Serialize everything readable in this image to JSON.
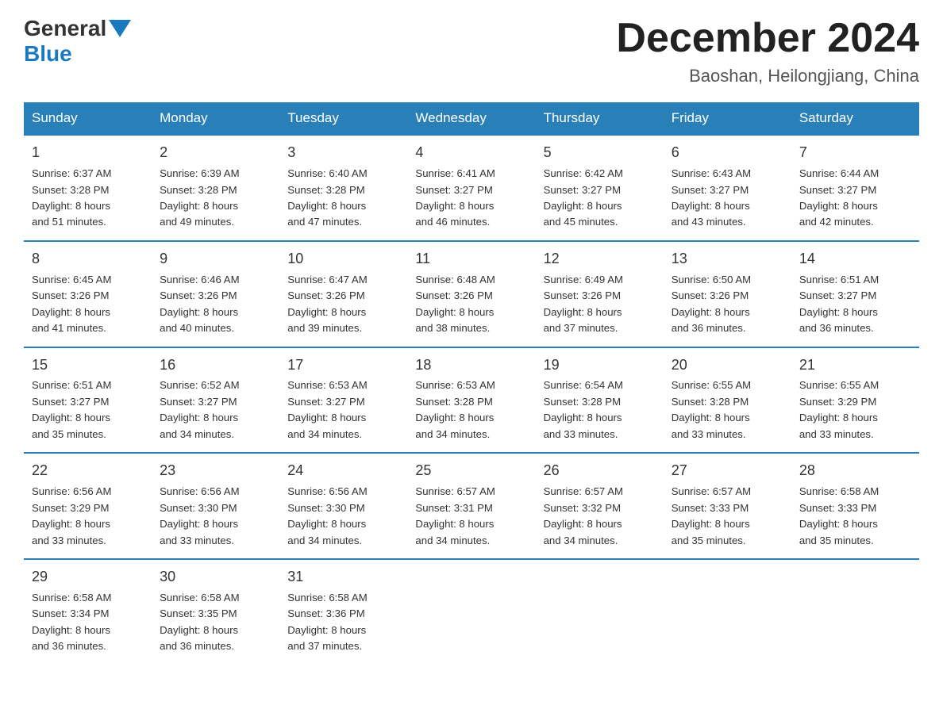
{
  "logo": {
    "general": "General",
    "blue": "Blue"
  },
  "title": "December 2024",
  "subtitle": "Baoshan, Heilongjiang, China",
  "days_of_week": [
    "Sunday",
    "Monday",
    "Tuesday",
    "Wednesday",
    "Thursday",
    "Friday",
    "Saturday"
  ],
  "weeks": [
    [
      {
        "day": "1",
        "sunrise": "6:37 AM",
        "sunset": "3:28 PM",
        "daylight": "8 hours and 51 minutes."
      },
      {
        "day": "2",
        "sunrise": "6:39 AM",
        "sunset": "3:28 PM",
        "daylight": "8 hours and 49 minutes."
      },
      {
        "day": "3",
        "sunrise": "6:40 AM",
        "sunset": "3:28 PM",
        "daylight": "8 hours and 47 minutes."
      },
      {
        "day": "4",
        "sunrise": "6:41 AM",
        "sunset": "3:27 PM",
        "daylight": "8 hours and 46 minutes."
      },
      {
        "day": "5",
        "sunrise": "6:42 AM",
        "sunset": "3:27 PM",
        "daylight": "8 hours and 45 minutes."
      },
      {
        "day": "6",
        "sunrise": "6:43 AM",
        "sunset": "3:27 PM",
        "daylight": "8 hours and 43 minutes."
      },
      {
        "day": "7",
        "sunrise": "6:44 AM",
        "sunset": "3:27 PM",
        "daylight": "8 hours and 42 minutes."
      }
    ],
    [
      {
        "day": "8",
        "sunrise": "6:45 AM",
        "sunset": "3:26 PM",
        "daylight": "8 hours and 41 minutes."
      },
      {
        "day": "9",
        "sunrise": "6:46 AM",
        "sunset": "3:26 PM",
        "daylight": "8 hours and 40 minutes."
      },
      {
        "day": "10",
        "sunrise": "6:47 AM",
        "sunset": "3:26 PM",
        "daylight": "8 hours and 39 minutes."
      },
      {
        "day": "11",
        "sunrise": "6:48 AM",
        "sunset": "3:26 PM",
        "daylight": "8 hours and 38 minutes."
      },
      {
        "day": "12",
        "sunrise": "6:49 AM",
        "sunset": "3:26 PM",
        "daylight": "8 hours and 37 minutes."
      },
      {
        "day": "13",
        "sunrise": "6:50 AM",
        "sunset": "3:26 PM",
        "daylight": "8 hours and 36 minutes."
      },
      {
        "day": "14",
        "sunrise": "6:51 AM",
        "sunset": "3:27 PM",
        "daylight": "8 hours and 36 minutes."
      }
    ],
    [
      {
        "day": "15",
        "sunrise": "6:51 AM",
        "sunset": "3:27 PM",
        "daylight": "8 hours and 35 minutes."
      },
      {
        "day": "16",
        "sunrise": "6:52 AM",
        "sunset": "3:27 PM",
        "daylight": "8 hours and 34 minutes."
      },
      {
        "day": "17",
        "sunrise": "6:53 AM",
        "sunset": "3:27 PM",
        "daylight": "8 hours and 34 minutes."
      },
      {
        "day": "18",
        "sunrise": "6:53 AM",
        "sunset": "3:28 PM",
        "daylight": "8 hours and 34 minutes."
      },
      {
        "day": "19",
        "sunrise": "6:54 AM",
        "sunset": "3:28 PM",
        "daylight": "8 hours and 33 minutes."
      },
      {
        "day": "20",
        "sunrise": "6:55 AM",
        "sunset": "3:28 PM",
        "daylight": "8 hours and 33 minutes."
      },
      {
        "day": "21",
        "sunrise": "6:55 AM",
        "sunset": "3:29 PM",
        "daylight": "8 hours and 33 minutes."
      }
    ],
    [
      {
        "day": "22",
        "sunrise": "6:56 AM",
        "sunset": "3:29 PM",
        "daylight": "8 hours and 33 minutes."
      },
      {
        "day": "23",
        "sunrise": "6:56 AM",
        "sunset": "3:30 PM",
        "daylight": "8 hours and 33 minutes."
      },
      {
        "day": "24",
        "sunrise": "6:56 AM",
        "sunset": "3:30 PM",
        "daylight": "8 hours and 34 minutes."
      },
      {
        "day": "25",
        "sunrise": "6:57 AM",
        "sunset": "3:31 PM",
        "daylight": "8 hours and 34 minutes."
      },
      {
        "day": "26",
        "sunrise": "6:57 AM",
        "sunset": "3:32 PM",
        "daylight": "8 hours and 34 minutes."
      },
      {
        "day": "27",
        "sunrise": "6:57 AM",
        "sunset": "3:33 PM",
        "daylight": "8 hours and 35 minutes."
      },
      {
        "day": "28",
        "sunrise": "6:58 AM",
        "sunset": "3:33 PM",
        "daylight": "8 hours and 35 minutes."
      }
    ],
    [
      {
        "day": "29",
        "sunrise": "6:58 AM",
        "sunset": "3:34 PM",
        "daylight": "8 hours and 36 minutes."
      },
      {
        "day": "30",
        "sunrise": "6:58 AM",
        "sunset": "3:35 PM",
        "daylight": "8 hours and 36 minutes."
      },
      {
        "day": "31",
        "sunrise": "6:58 AM",
        "sunset": "3:36 PM",
        "daylight": "8 hours and 37 minutes."
      },
      null,
      null,
      null,
      null
    ]
  ],
  "labels": {
    "sunrise": "Sunrise:",
    "sunset": "Sunset:",
    "daylight": "Daylight:"
  }
}
